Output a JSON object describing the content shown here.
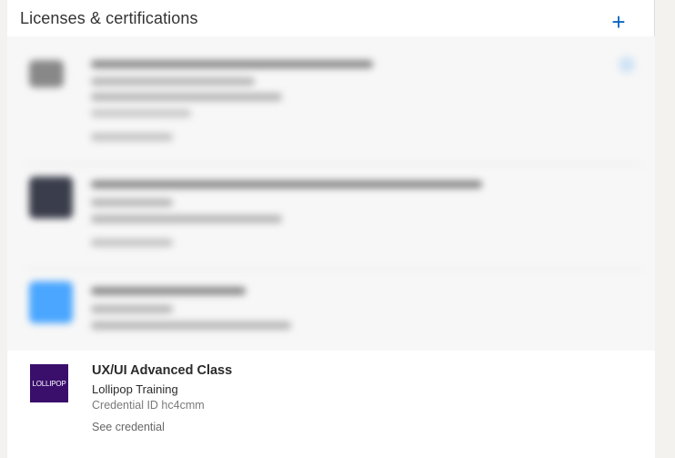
{
  "section": {
    "title": "Licenses & certifications",
    "add_icon": "plus-icon",
    "add_glyph": "+"
  },
  "colors": {
    "accent": "#0a66c2",
    "logo_bg": "#3a0f6c"
  },
  "certification": {
    "title": "UX/UI Advanced Class",
    "issuer": "Lollipop Training",
    "credential_id": "Credential ID hc4cmm",
    "link_label": "See credential",
    "logo_text": "LOLLIPOP"
  }
}
